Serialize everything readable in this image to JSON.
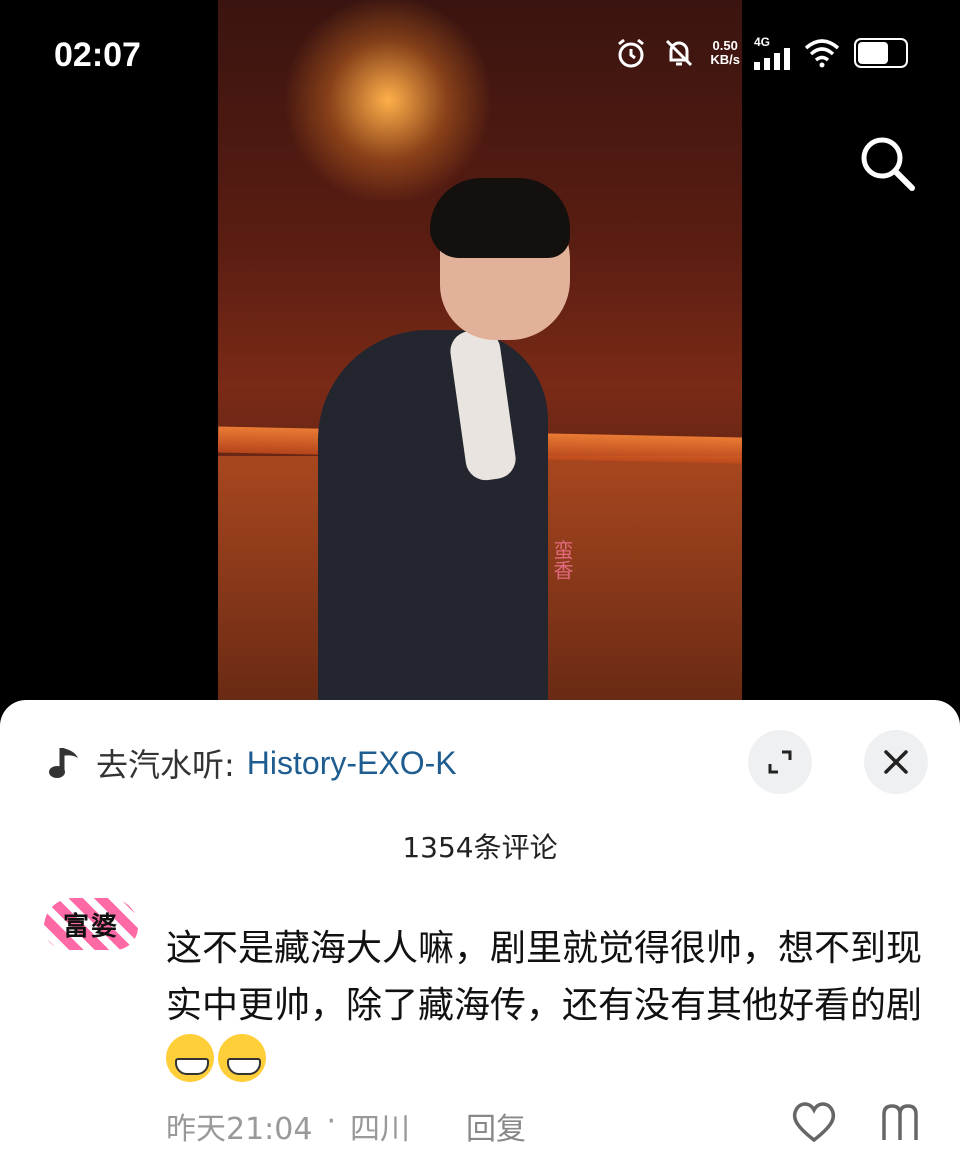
{
  "status_bar": {
    "time": "02:07",
    "net_speed_value": "0.50",
    "net_speed_unit": "KB/s",
    "network_type": "4G",
    "icons": [
      "alarm-icon",
      "mute-icon",
      "signal-icon",
      "wifi-icon",
      "battery-icon"
    ],
    "battery_level": 0.6
  },
  "video": {
    "watermark": "蛮香"
  },
  "music": {
    "label": "去汽水听:",
    "song": "History-EXO-K"
  },
  "comments": {
    "count_label": "1354条评论",
    "items": [
      {
        "avatar_text": "富婆",
        "text": "这不是藏海大人嘛，剧里就觉得很帅，想不到现实中更帅，除了藏海传，还有没有其他好看的剧",
        "time": "昨天21:04",
        "separator": "·",
        "location": "四川",
        "reply_label": "回复"
      }
    ]
  },
  "colors": {
    "song_link": "#1f5c8f",
    "sheet_bg": "#ffffff",
    "meta_text": "#999999"
  }
}
